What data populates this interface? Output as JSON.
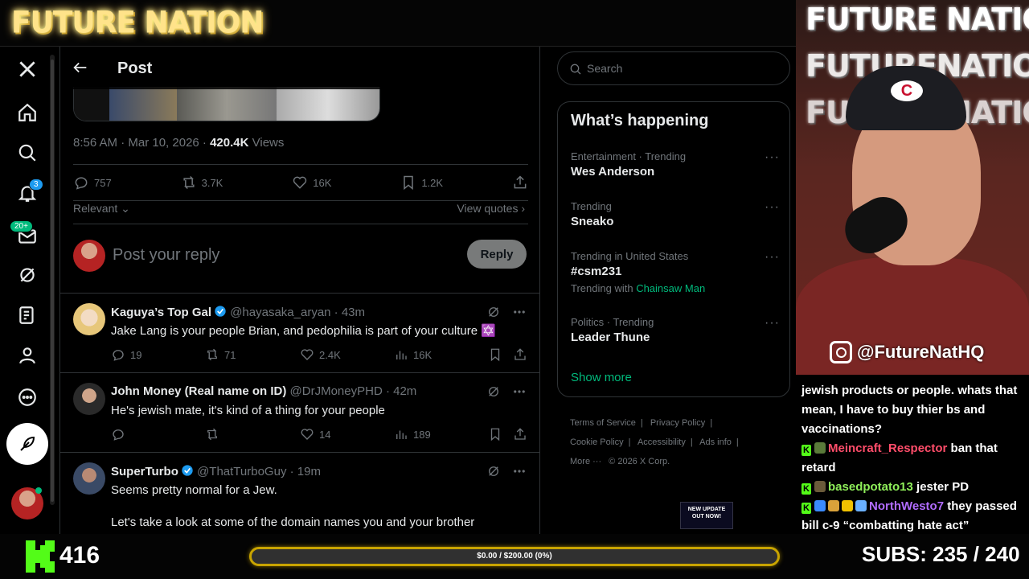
{
  "overlay": {
    "brand_title": "FUTURE NATION",
    "cam_title_lines": [
      "FUTURE NATION",
      "FUTURENATION",
      "FUTURE NATION"
    ],
    "cam_handle": "@FutureNatHQ",
    "cap_logo": "C"
  },
  "nav": {
    "notifications_badge": "3",
    "messages_badge": "20+"
  },
  "post": {
    "header_title": "Post",
    "meta_time": "8:56 AM · Mar 10, 2026 · ",
    "meta_views_count": "420.4K",
    "meta_views_label": " Views",
    "stats": {
      "replies": "757",
      "reposts": "3.7K",
      "likes": "16K",
      "bookmarks": "1.2K"
    },
    "sort_label": "Relevant",
    "view_quotes_label": "View quotes",
    "reply_placeholder": "Post your reply",
    "reply_button": "Reply"
  },
  "replies": [
    {
      "name": "Kaguya’s Top Gal",
      "handle": "@hayasaka_aryan · 43m",
      "text": "Jake Lang is your people Brian, and pedophilia is part of your culture ✡️",
      "replies": "19",
      "reposts": "71",
      "likes": "2.4K",
      "views": "16K",
      "avatar_color": "#e7c77a"
    },
    {
      "name": "John Money (Real name on ID)",
      "handle": "@DrJMoneyPHD · 42m",
      "text": "He's jewish mate, it's kind of a thing for your people",
      "replies": "",
      "reposts": "",
      "likes": "14",
      "views": "189",
      "avatar_color": "#444"
    },
    {
      "name": "SuperTurbo",
      "handle": "@ThatTurboGuy · 19m",
      "text_line1": "Seems pretty normal for a Jew.",
      "text_line2": "Let's take a look at some of the domain names you and your brother",
      "avatar_color": "#556"
    }
  ],
  "search": {
    "placeholder": "Search"
  },
  "trends": {
    "title": "What’s happening",
    "items": [
      {
        "meta": "Entertainment · Trending",
        "name": "Wes Anderson"
      },
      {
        "meta": "Trending",
        "name": "Sneako"
      },
      {
        "meta": "Trending in United States",
        "name": "#csm231",
        "with_prefix": "Trending with",
        "with_link": "Chainsaw Man"
      },
      {
        "meta": "Politics · Trending",
        "name": "Leader Thune"
      }
    ],
    "show_more": "Show more"
  },
  "footer": {
    "links": [
      "Terms of Service",
      "|",
      "Privacy Policy",
      "|",
      "Cookie Policy",
      "|",
      "Accessibility",
      "|",
      "Ads info",
      "|",
      "More ···",
      "© 2026 X Corp."
    ]
  },
  "promo": {
    "line1": "NEW UPDATE",
    "line2": "OUT NOW!"
  },
  "chat": {
    "lines": [
      {
        "text": "jewish products or people. whats that mean, I have to buy thier bs and vaccinations?"
      },
      {
        "user": "Meincraft_Respector",
        "text": " ban that retard",
        "color": "red"
      },
      {
        "user": "basedpotato13",
        "text": " jester PD",
        "color": "green"
      },
      {
        "user": "NorthWesto7",
        "text": " they passed bill c-9 “combatting hate act”",
        "color": "purple"
      }
    ]
  },
  "bottom": {
    "follower_count": "416",
    "goal_text": "$0.00 / $200.00 (0%)",
    "goal_fraction": 0,
    "subs_text": "SUBS:  235 / 240"
  },
  "colors": {
    "accent_green": "#00ba7c",
    "kick_green": "#53fc18",
    "goal_border": "#c8a400"
  }
}
